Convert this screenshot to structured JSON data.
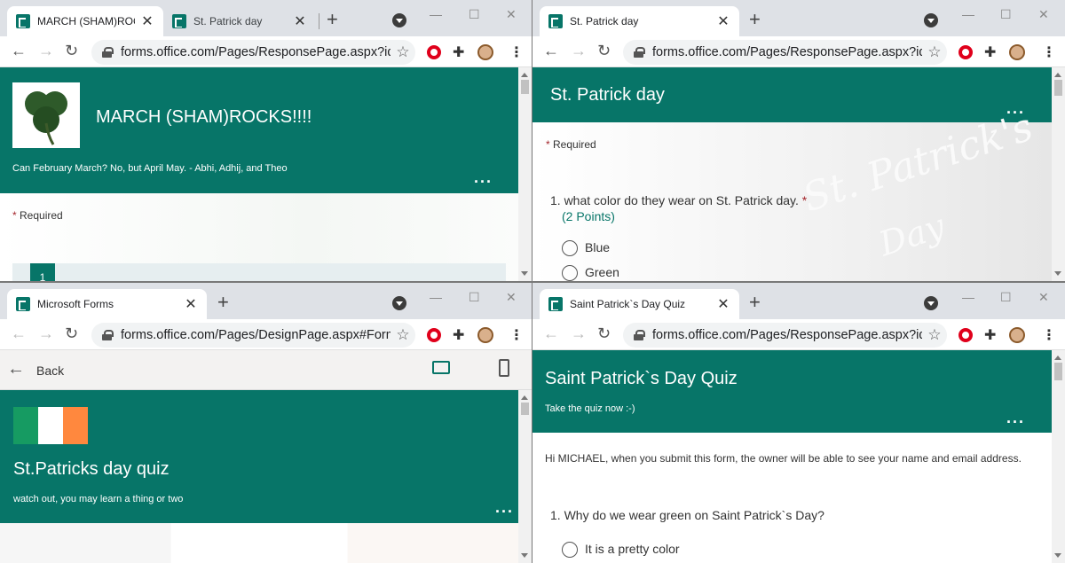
{
  "w1": {
    "tabs": [
      "MARCH (SHAM)ROCKS!!!!",
      "St. Patrick day"
    ],
    "url": "forms.office.com/Pages/ResponsePage.aspx?id=j...",
    "form_title": "MARCH (SHAM)ROCKS!!!!",
    "form_desc": "Can February March? No, but April May. - Abhi, Adhij, and Theo",
    "more": "...",
    "required_mark": "*",
    "required": "Required",
    "q1_number": "1"
  },
  "w2": {
    "tab": "St. Patrick day",
    "url": "forms.office.com/Pages/ResponsePage.aspx?id=j...",
    "form_title": "St. Patrick day",
    "more": "...",
    "required_mark": "*",
    "required": "Required",
    "watermark_line1": "St. Patrick's",
    "watermark_line2": "Day",
    "q1": "1. what color do they wear on St. Patrick day.",
    "q1_star": "*",
    "q1_points": "(2 Points)",
    "options": [
      "Blue",
      "Green"
    ]
  },
  "w3": {
    "tab": "Microsoft Forms",
    "url": "forms.office.com/Pages/DesignPage.aspx#FormId...",
    "back": "Back",
    "form_title": "St.Patricks day quiz",
    "form_desc": "watch out, you may learn a thing or two",
    "more": "...",
    "flag_colors": [
      "#169b62",
      "#ffffff",
      "#ff883e"
    ]
  },
  "w4": {
    "tab": "Saint Patrick`s Day Quiz",
    "url": "forms.office.com/Pages/ResponsePage.aspx?id=j...",
    "form_title": "Saint Patrick`s Day Quiz",
    "form_desc": "Take the quiz now :-)",
    "more": "...",
    "notice": "Hi MICHAEL, when you submit this form, the owner will be able to see your name and email address.",
    "q1": "1. Why do we wear green on Saint Patrick`s Day?",
    "options": [
      "It is a pretty color"
    ]
  },
  "accent": "#077568"
}
